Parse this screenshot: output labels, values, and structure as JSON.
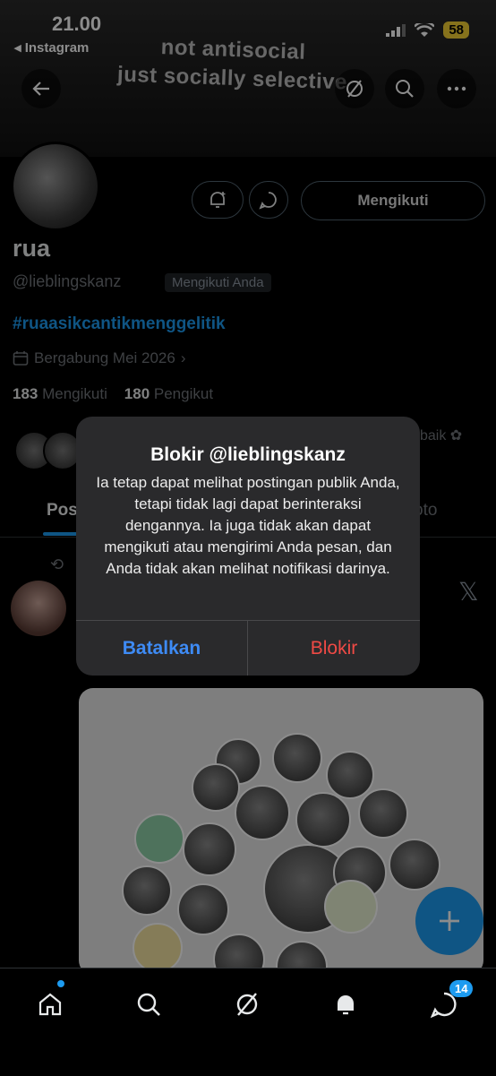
{
  "status_bar": {
    "time": "21.00",
    "back_app": "◂ Instagram",
    "battery": "58"
  },
  "banner": {
    "line1": "not antisocial",
    "line2": "just socially selective"
  },
  "header": {
    "back_icon": "arrow-left-icon",
    "grok_icon": "grok-icon",
    "search_icon": "search-icon",
    "more_icon": "more-icon"
  },
  "profile": {
    "name": "rua",
    "handle": "@lieblingskanz",
    "follows_you": "Mengikuti Anda",
    "bio": "#ruaasikcantikmenggelitik",
    "joined": "Bergabung Mei 2026",
    "following_count": "183",
    "following_label": "Mengikuti",
    "followers_count": "180",
    "followers_label": "Pengikut",
    "follow_button": "Mengikuti",
    "mutuals_tail": "baik ✿"
  },
  "tabs": {
    "posts": "Pos",
    "media": "oto"
  },
  "dialog": {
    "title": "Blokir @lieblingskanz",
    "message": "Ia tetap dapat melihat postingan publik Anda, tetapi tidak lagi dapat berinteraksi dengannya. Ia juga tidak akan dapat mengikuti atau mengirimi Anda pesan, dan Anda tidak akan melihat notifikasi darinya.",
    "cancel": "Batalkan",
    "confirm": "Blokir"
  },
  "bottom_nav": {
    "messages_badge": "14"
  },
  "colors": {
    "accent": "#1d9bf0",
    "cancel": "#3e8bf5",
    "destructive": "#f04a45"
  }
}
